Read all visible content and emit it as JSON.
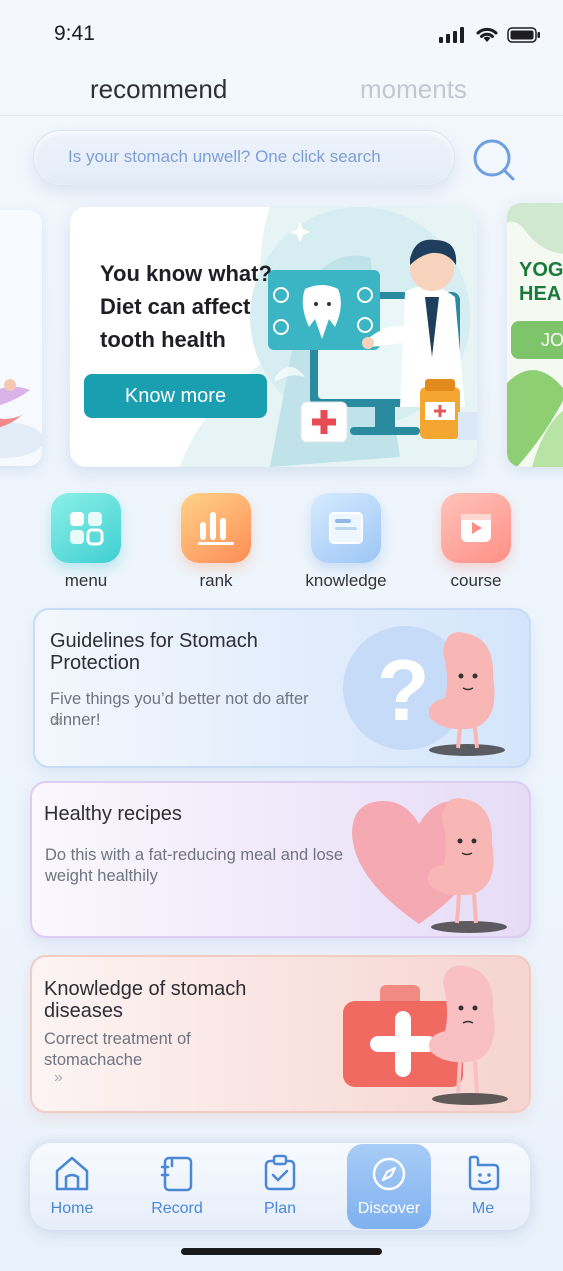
{
  "status_bar": {
    "time": "9:41"
  },
  "tabs": {
    "recommend": "recommend",
    "moments": "moments"
  },
  "search": {
    "placeholder": "Is your stomach unwell? One click search"
  },
  "banner": {
    "text": "You know what? Diet can affect tooth health",
    "button": "Know more",
    "right_peek_text": "YOG HEA",
    "right_peek_button": "JO"
  },
  "quick_menu": [
    {
      "label": "menu",
      "icon": "grid-icon"
    },
    {
      "label": "rank",
      "icon": "bar-chart-icon"
    },
    {
      "label": "knowledge",
      "icon": "book-icon"
    },
    {
      "label": "course",
      "icon": "video-icon"
    }
  ],
  "cards": [
    {
      "title": "Guidelines for Stomach Protection",
      "desc": "Five things you’d better not do after dinner!",
      "arrow": "»"
    },
    {
      "title": "Healthy recipes",
      "desc": "Do this with a fat-reducing meal and lose weight healthily"
    },
    {
      "title": "Knowledge of stomach diseases",
      "desc": "Correct treatment of stomachache",
      "arrow": "»"
    }
  ],
  "nav": [
    {
      "label": "Home",
      "icon": "home-icon"
    },
    {
      "label": "Record",
      "icon": "record-icon"
    },
    {
      "label": "Plan",
      "icon": "plan-icon"
    },
    {
      "label": "Discover",
      "icon": "compass-icon",
      "active": true
    },
    {
      "label": "Me",
      "icon": "me-icon"
    }
  ],
  "colors": {
    "accent": "#4a88d6",
    "banner_button": "#1a9fb0",
    "active_nav": "#8ab9f2"
  }
}
